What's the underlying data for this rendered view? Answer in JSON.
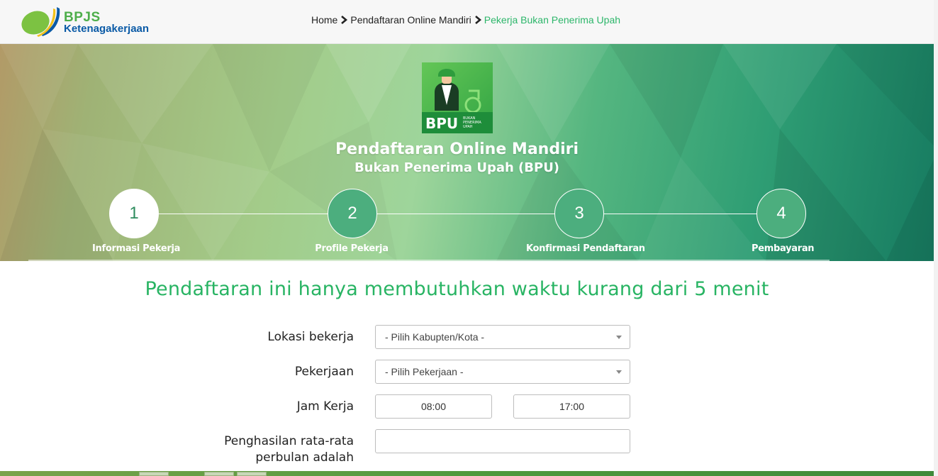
{
  "header": {
    "logo": {
      "line1": "BPJS",
      "line2": "Ketenagakerjaan"
    },
    "breadcrumb": [
      {
        "label": "Home"
      },
      {
        "label": "Pendaftaran Online Mandiri"
      },
      {
        "label": "Pekerja Bukan Penerima Upah"
      }
    ]
  },
  "hero": {
    "badge": {
      "text": "BPU",
      "small_text": [
        "BUKAN",
        "PENERIMA",
        "UPAH"
      ]
    },
    "title": "Pendaftaran Online Mandiri",
    "subtitle": "Bukan Penerima Upah (BPU)",
    "steps": [
      {
        "number": "1",
        "label": "Informasi Pekerja",
        "active": true
      },
      {
        "number": "2",
        "label": "Profile Pekerja",
        "active": false
      },
      {
        "number": "3",
        "label": "Konfirmasi Pendaftaran",
        "active": false
      },
      {
        "number": "4",
        "label": "Pembayaran",
        "active": false
      }
    ]
  },
  "form": {
    "tagline": "Pendaftaran ini hanya membutuhkan waktu kurang dari 5 menit",
    "lokasi": {
      "label": "Lokasi bekerja",
      "value": "- Pilih Kabupten/Kota -"
    },
    "pekerjaan": {
      "label": "Pekerjaan",
      "value": "- Pilih Pekerjaan -"
    },
    "jam_kerja": {
      "label": "Jam Kerja",
      "start": "08:00",
      "end": "17:00"
    },
    "penghasilan": {
      "label_line1": "Penghasilan rata-rata",
      "label_line2": "perbulan adalah",
      "value": ""
    }
  },
  "colors": {
    "brand_green": "#28b463",
    "logo_green": "#4dae4a",
    "logo_blue": "#0a5aa6",
    "breadcrumb_active": "#2cb66a"
  }
}
